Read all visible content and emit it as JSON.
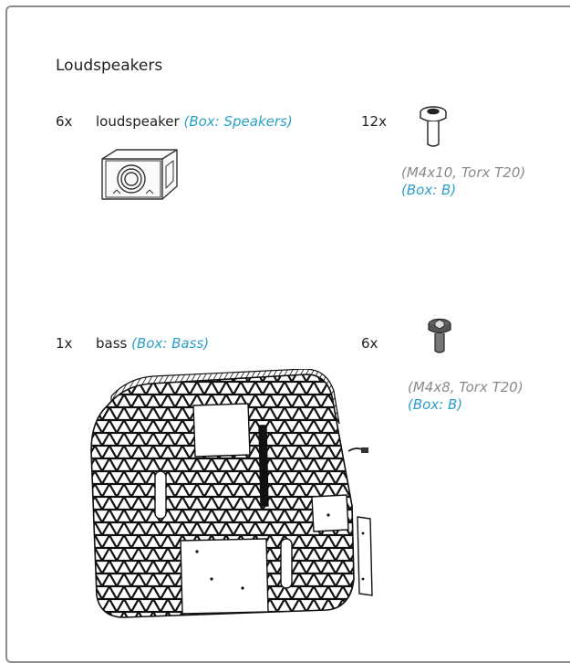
{
  "section_title": "Loudspeakers",
  "items": [
    {
      "qty": "6x",
      "name": "loudspeaker",
      "box": "(Box: Speakers)"
    },
    {
      "qty": "12x",
      "spec": "(M4x10, Torx T20)",
      "box": "(Box: B)"
    },
    {
      "qty": "1x",
      "name": "bass",
      "box": "(Box: Bass)"
    },
    {
      "qty": "6x",
      "spec": "(M4x8, Torx T20)",
      "box": "(Box: B)"
    }
  ],
  "colors": {
    "box_label": "#2aa0c8",
    "spec_text": "#8a8a8a",
    "frame": "#8c8c8c"
  },
  "icons": [
    "loudspeaker-illustration",
    "screw-m4x10-illustration",
    "bass-unit-illustration",
    "screw-m4x8-illustration"
  ]
}
